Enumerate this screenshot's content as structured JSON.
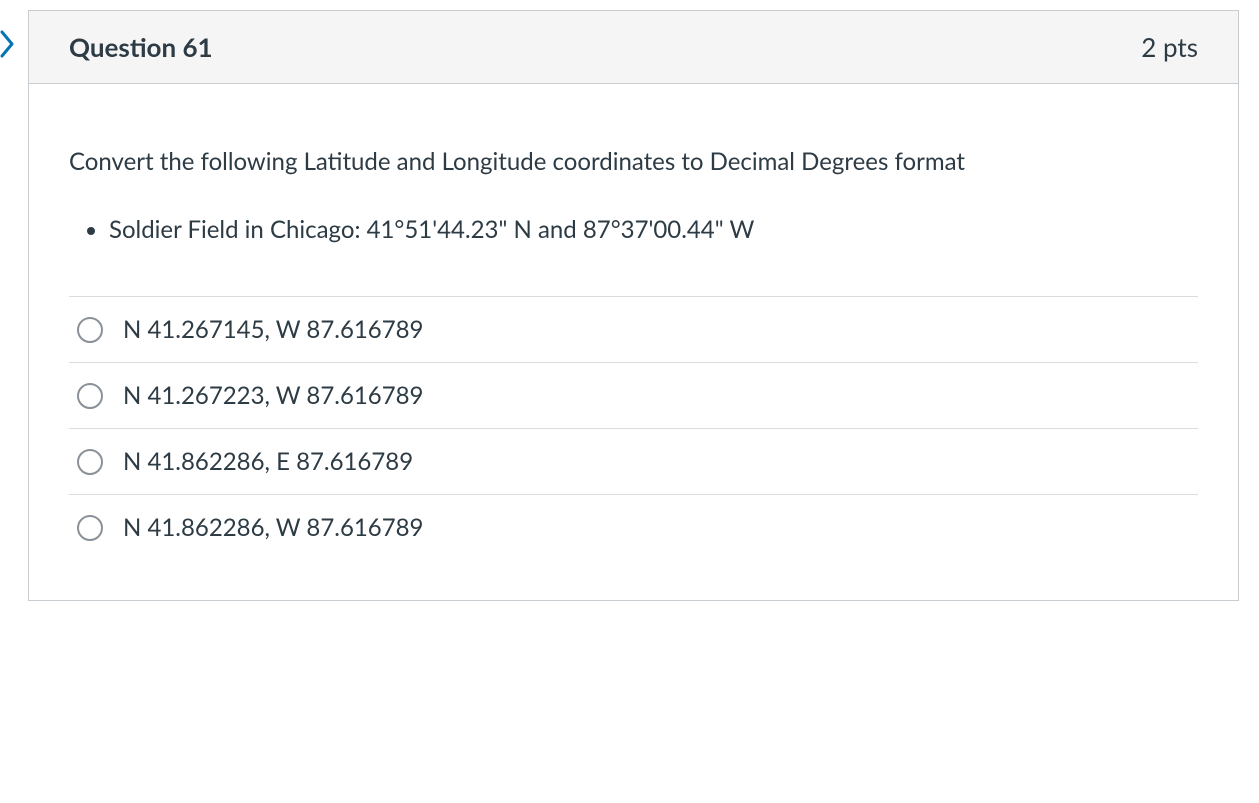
{
  "question": {
    "title": "Question 61",
    "points": "2 pts",
    "prompt": "Convert the following Latitude and Longitude coordinates to Decimal Degrees format",
    "bullet": "Soldier Field in Chicago: 41°51'44.23\" N and 87°37'00.44\" W",
    "answers": [
      "N 41.267145, W 87.616789",
      "N 41.267223, W 87.616789",
      "N 41.862286, E 87.616789",
      "N 41.862286, W 87.616789"
    ]
  }
}
